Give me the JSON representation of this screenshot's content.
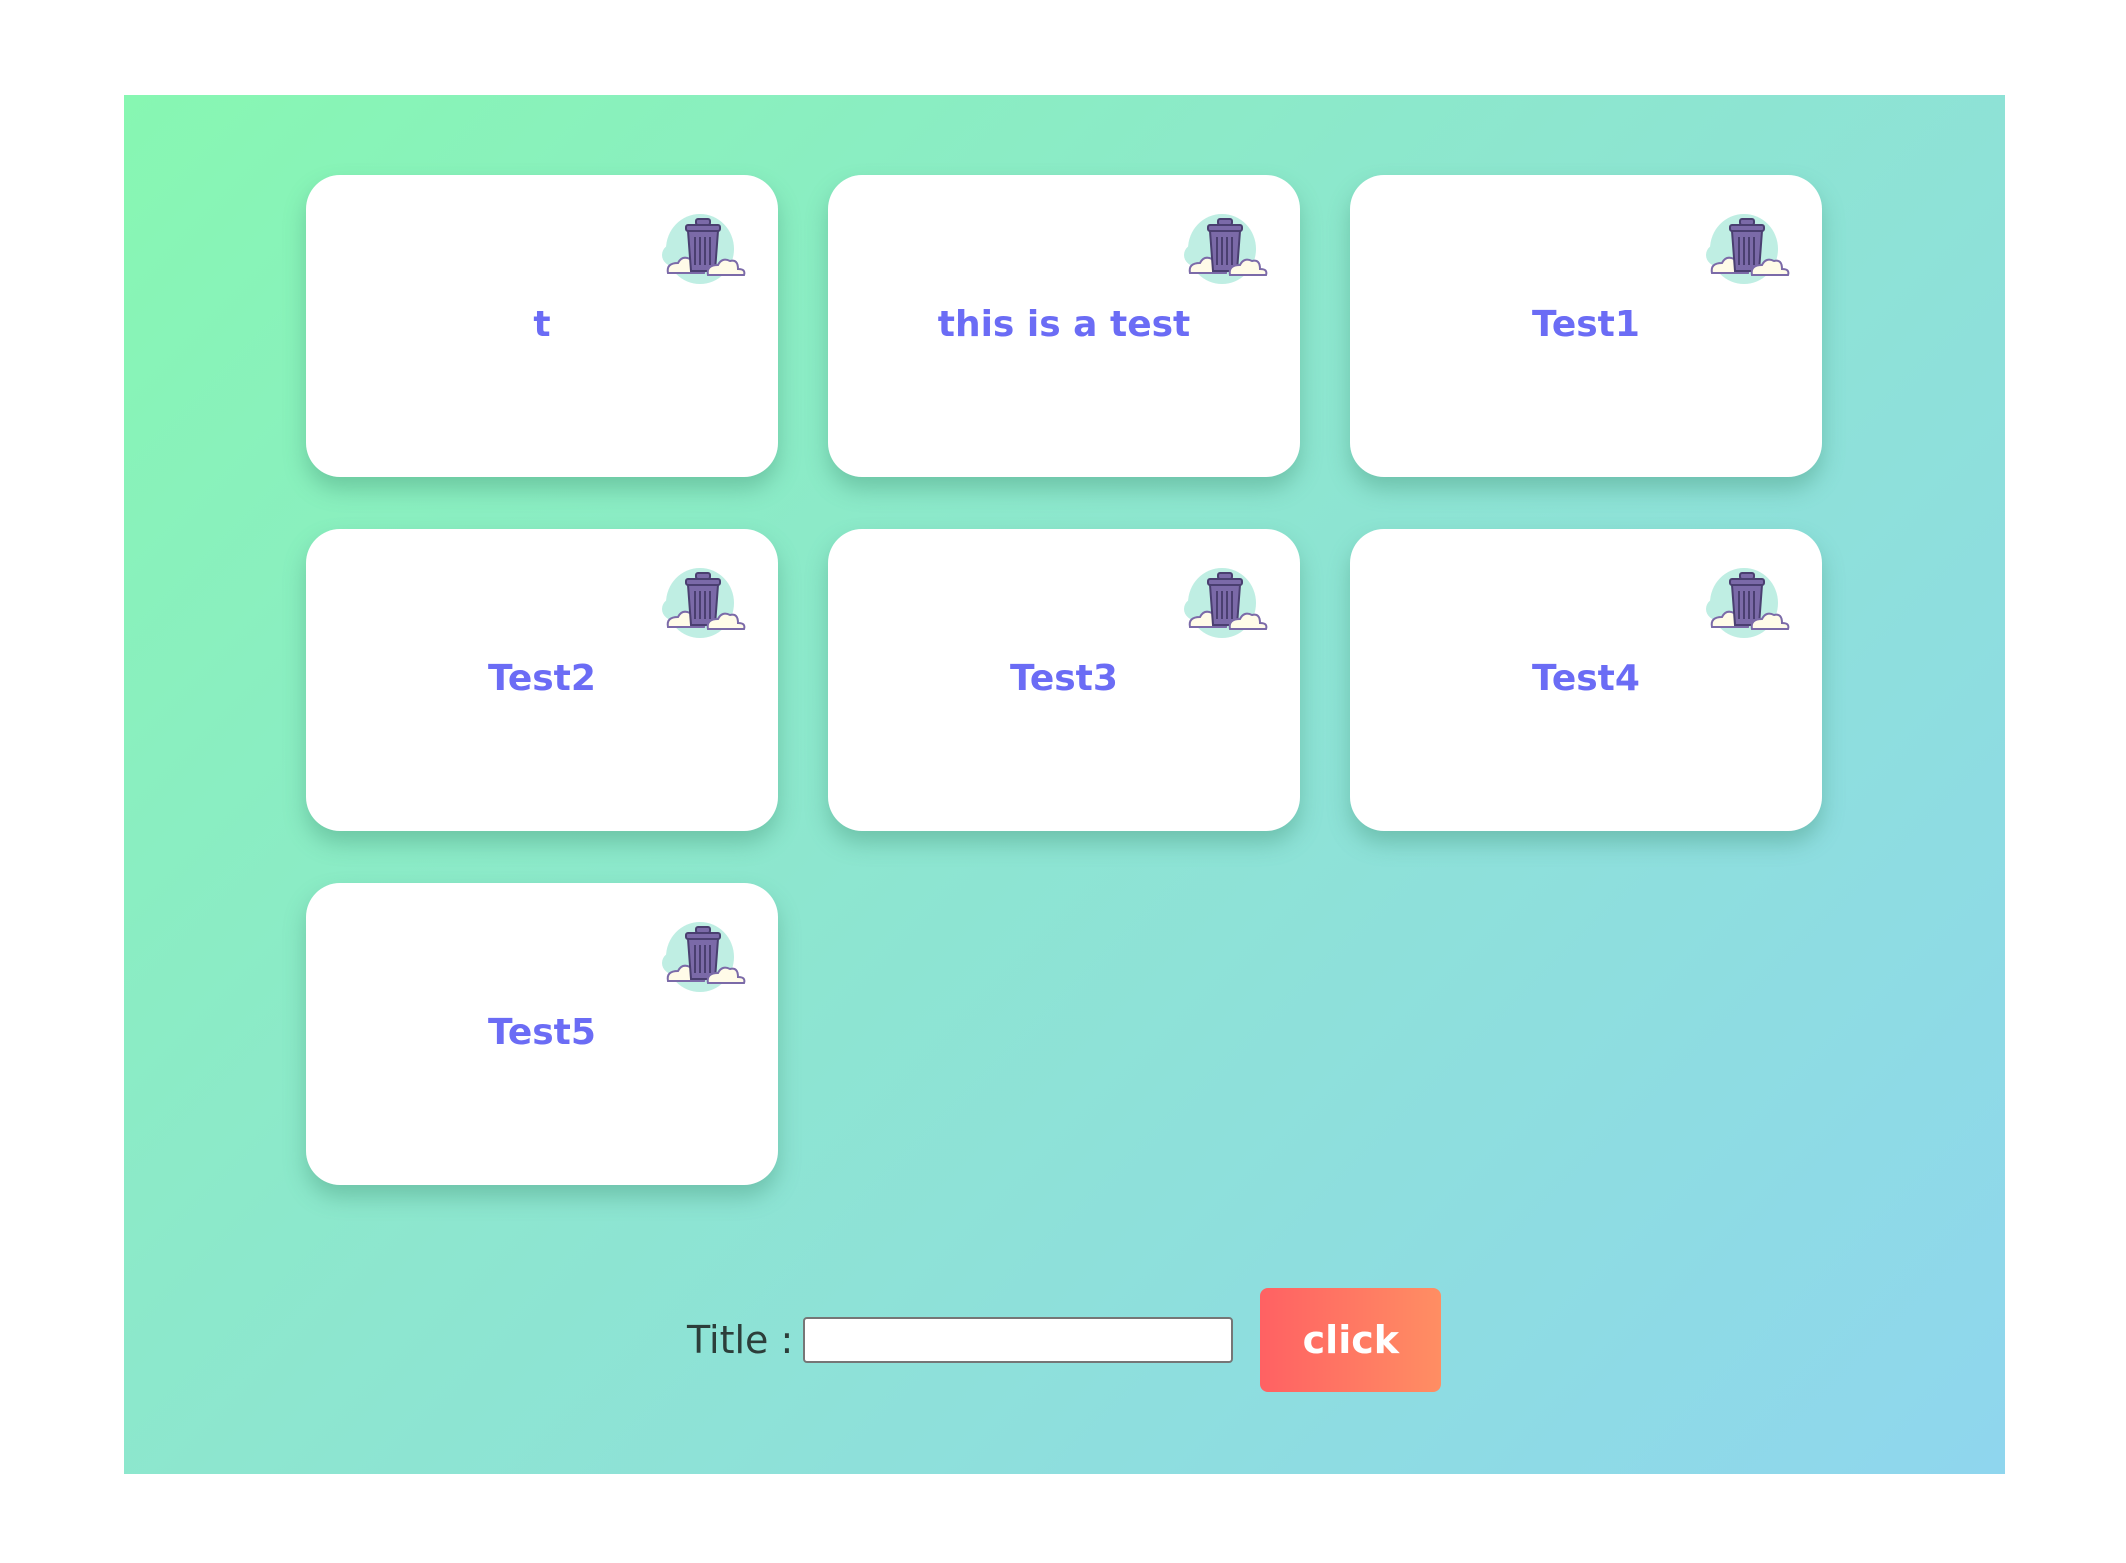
{
  "notes": [
    {
      "title": "t"
    },
    {
      "title": "this is a test"
    },
    {
      "title": "Test1"
    },
    {
      "title": "Test2"
    },
    {
      "title": "Test3"
    },
    {
      "title": "Test4"
    },
    {
      "title": "Test5"
    }
  ],
  "form": {
    "label": "Title :",
    "input_value": "",
    "button_label": "click"
  },
  "icons": {
    "delete": "trash-can-with-clouds-icon"
  },
  "colors": {
    "background_gradient": [
      "#87f7b2",
      "#8fd6ee"
    ],
    "card": "#ffffff",
    "title_text": "#6b6cf5",
    "button_gradient": [
      "#ff6163",
      "#ff8e63"
    ],
    "trash": "#7b6aa8",
    "cloud_bg": "#bfeee3"
  }
}
